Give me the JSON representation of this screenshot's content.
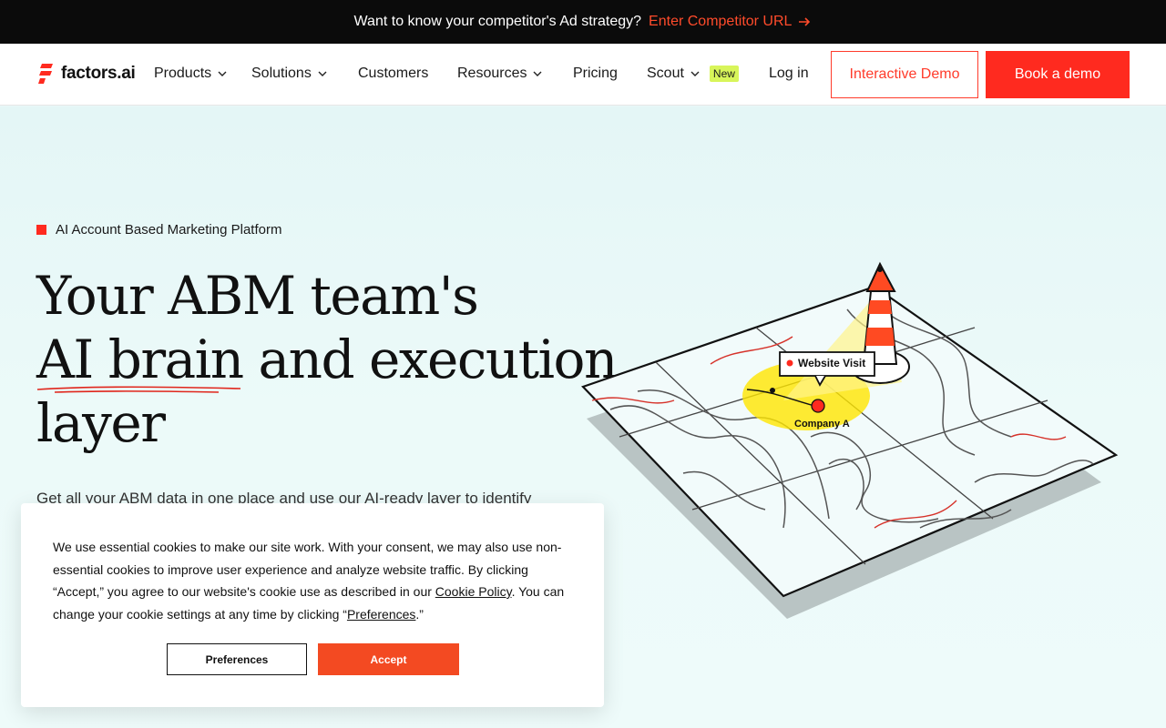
{
  "announcement": {
    "text": "Want to know your competitor's Ad strategy?",
    "cta": "Enter Competitor URL"
  },
  "brand": {
    "name": "factors.ai",
    "accent": "#ff2a1f"
  },
  "nav": {
    "items": [
      {
        "label": "Products",
        "dropdown": true
      },
      {
        "label": "Solutions",
        "dropdown": true
      },
      {
        "label": "Customers",
        "dropdown": false
      },
      {
        "label": "Resources",
        "dropdown": true
      },
      {
        "label": "Pricing",
        "dropdown": false
      },
      {
        "label": "Scout",
        "dropdown": true,
        "badge": "New"
      }
    ],
    "login": "Log in",
    "interactive_demo": "Interactive Demo",
    "book_demo": "Book a demo"
  },
  "hero": {
    "eyebrow": "AI Account Based Marketing Platform",
    "headline_lines": [
      "Your ABM team's",
      "AI brain and execution",
      "layer"
    ],
    "subtext": "Get all your ABM data in one place and use our AI-ready layer to identify"
  },
  "illustration": {
    "callout": "Website Visit",
    "marker_label": "Company A"
  },
  "cookie": {
    "text_before_policy": "We use essential cookies to make our site work. With your consent, we may also use non-essential cookies to improve user experience and analyze website traffic. By clicking “Accept,” you agree to our website's cookie use as described in our ",
    "policy_link": "Cookie Policy",
    "text_middle": ". You can change your cookie settings at any time by clicking “",
    "preferences_link": "Preferences",
    "text_end": ".”",
    "preferences_button": "Preferences",
    "accept_button": "Accept"
  }
}
